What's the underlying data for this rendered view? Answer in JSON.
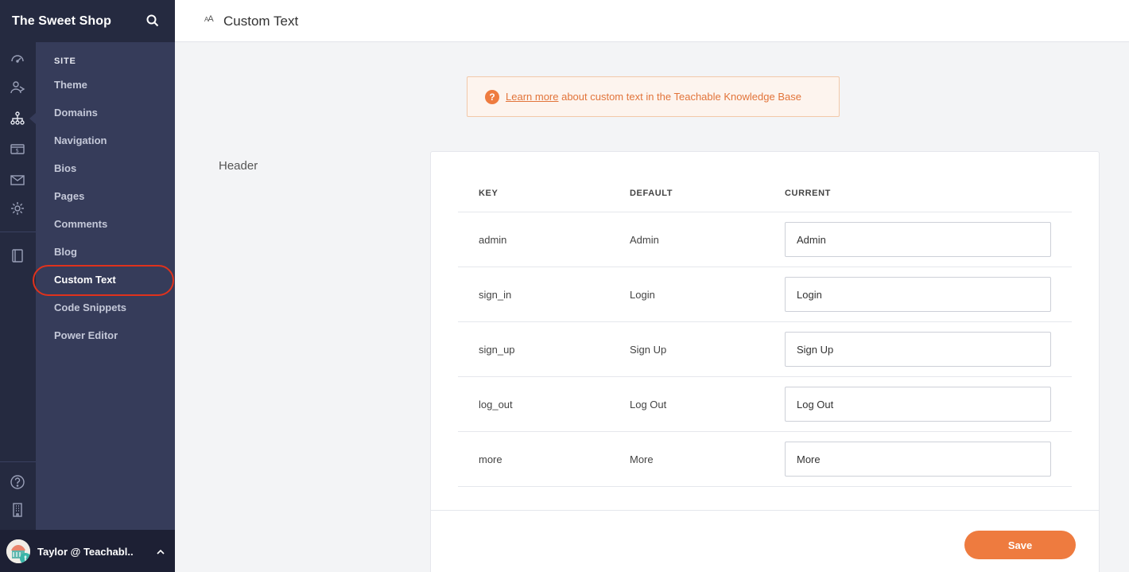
{
  "brand": {
    "title": "The Sweet Shop"
  },
  "rail": {
    "icons": [
      "dashboard-icon",
      "users-icon",
      "site-icon",
      "sales-icon",
      "email-icon",
      "settings-icon",
      "courses-icon",
      "help-icon",
      "building-icon"
    ],
    "active": "site-icon"
  },
  "subnav": {
    "heading": "SITE",
    "items": [
      {
        "label": "Theme"
      },
      {
        "label": "Domains"
      },
      {
        "label": "Navigation"
      },
      {
        "label": "Bios"
      },
      {
        "label": "Pages"
      },
      {
        "label": "Comments"
      },
      {
        "label": "Blog"
      },
      {
        "label": "Custom Text"
      },
      {
        "label": "Code Snippets"
      },
      {
        "label": "Power Editor"
      }
    ],
    "active_label": "Custom Text"
  },
  "user": {
    "name": "Taylor @ Teachabl..",
    "badge": "t"
  },
  "topbar": {
    "icon_text": "AA",
    "title": "Custom Text"
  },
  "banner": {
    "icon": "?",
    "link_text": "Learn more",
    "text": " about custom text in the Teachable Knowledge Base"
  },
  "section": {
    "label": "Header"
  },
  "table": {
    "columns": [
      "KEY",
      "DEFAULT",
      "CURRENT"
    ],
    "rows": [
      {
        "key": "admin",
        "default": "Admin",
        "current": "Admin"
      },
      {
        "key": "sign_in",
        "default": "Login",
        "current": "Login"
      },
      {
        "key": "sign_up",
        "default": "Sign Up",
        "current": "Sign Up"
      },
      {
        "key": "log_out",
        "default": "Log Out",
        "current": "Log Out"
      },
      {
        "key": "more",
        "default": "More",
        "current": "More"
      }
    ]
  },
  "actions": {
    "save_label": "Save"
  },
  "colors": {
    "accent": "#ee7b3f",
    "highlight": "#e0321c",
    "sidebar": "#363c5a",
    "rail": "#252a40"
  }
}
